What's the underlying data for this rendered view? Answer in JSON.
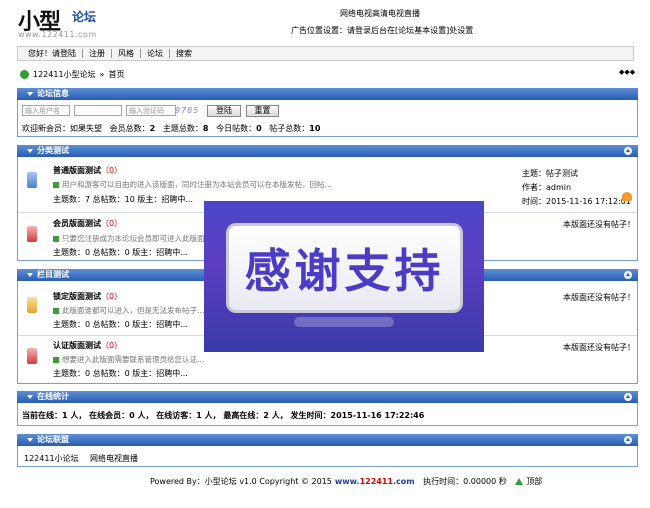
{
  "header": {
    "logo_big": "小型",
    "logo_small": "论坛",
    "logo_url": "www.122411.com",
    "top_link": "网络电视高清电视直播",
    "ad_text": "广告位置设置：请登录后台在[论坛基本设置]处设置"
  },
  "nav": {
    "items": [
      {
        "label": "您好！请登陆"
      },
      {
        "label": "注册"
      },
      {
        "label": "风格"
      },
      {
        "label": "论坛"
      },
      {
        "label": "搜索"
      }
    ]
  },
  "breadcrumb": {
    "site": "122411小型论坛",
    "sep": "»",
    "current": "首页",
    "arrows": "◆◆◆"
  },
  "forum_info": {
    "title": "论坛信息",
    "username_placeholder": "输入用户名",
    "captcha_placeholder": "输入验证码",
    "captcha_code": "9785",
    "login_label": "登陆",
    "reset_label": "重置",
    "stats": {
      "welcome_label": "欢迎新会员：",
      "new_member": "如果失望",
      "members_label": "会员总数：",
      "members": "2",
      "topics_label": "主题总数：",
      "topics": "8",
      "today_label": "今日帖数：",
      "today": "0",
      "posts_label": "帖子总数：",
      "posts": "10"
    }
  },
  "category_test": {
    "title": "分类测试",
    "forums": [
      {
        "name": "普通版面测试",
        "count": "（0）",
        "desc": "用户和游客可以自由的进入该版面，同时注册为本站会员可以在本版发帖，回帖…",
        "stats": "主题数：7  总帖数：10    版主：招聘中...",
        "last_topic_label": "主题：",
        "last_topic": "帖子测试",
        "author_label": "作者：",
        "author": "admin",
        "time_label": "时间：",
        "time": "2015-11-16 17:12:01"
      },
      {
        "name": "会员版面测试",
        "count": "（0）",
        "desc": "只要您注册成为本论坛会员即可进入此版面",
        "stats": "主题数：0  总帖数：0    版主：招聘中...",
        "no_posts": "本版面还没有帖子！"
      }
    ]
  },
  "column_test": {
    "title": "栏目测试",
    "forums": [
      {
        "name": "锁定版面测试",
        "count": "（0）",
        "desc": "此版面谁都可以进入，但是无法发布帖子…",
        "stats": "主题数：0  总帖数：0    版主：招聘中...",
        "no_posts": "本版面还没有帖子！"
      },
      {
        "name": "认证版面测试",
        "count": "（0）",
        "desc": "想要进入此版面需要联系管理员给您认证…",
        "stats": "主题数：0  总帖数：0    版主：招聘中...",
        "no_posts": "本版面还没有帖子！"
      }
    ]
  },
  "online": {
    "title": "在线统计",
    "text": "当前在线：1 人，  在线会员：0 人，  在线访客：1 人，  最高在线：2 人，  发生时间：2015-11-16 17:22:46"
  },
  "links": {
    "title": "论坛联盟",
    "items": [
      "122411小论坛",
      "网络电视直播"
    ]
  },
  "overlay": {
    "text": "感谢支持"
  },
  "footer": {
    "powered": "Powered By：小型论坛 v1.0  Copyright © 2015",
    "domain_www": "www.",
    "domain_num": "122411",
    "domain_com": ".com",
    "exec": "执行时间：0.00000 秒",
    "top": "顶部"
  },
  "colors": {
    "bar_top": "#5d8fd6",
    "bar_bottom": "#2a5db3",
    "count_red": "#dd0000",
    "overlay_bg": "#4a46c8",
    "overlay_text": "#4a3cc4"
  }
}
